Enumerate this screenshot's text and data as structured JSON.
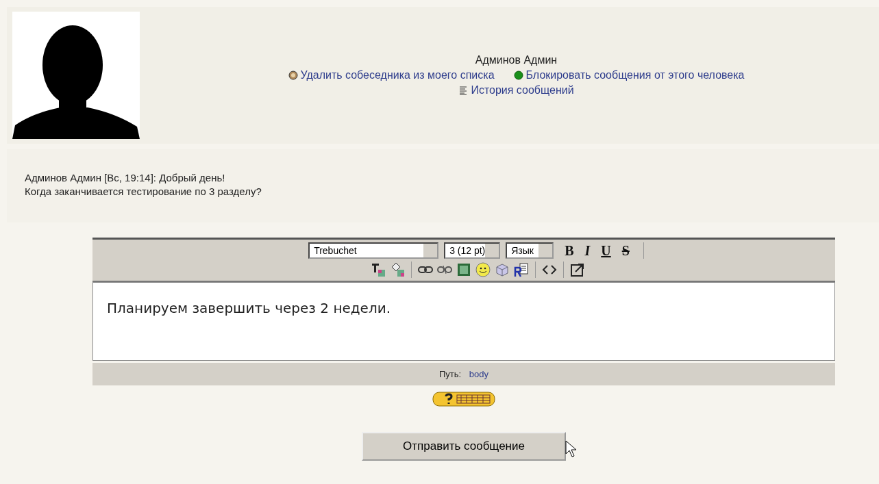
{
  "contact": {
    "name": "Админов Админ",
    "actions": [
      {
        "kind": "remove",
        "label": "Удалить собеседника из моего списка"
      },
      {
        "kind": "block",
        "label": "Блокировать сообщения от этого человека"
      },
      {
        "kind": "history",
        "label": "История сообщений"
      }
    ]
  },
  "message": {
    "lines": [
      "Админов Админ [Вс, 19:14]: Добрый день!",
      "Когда заканчивается тестирование по 3 разделу?"
    ]
  },
  "editor": {
    "font": "Trebuchet",
    "size": "3 (12 pt)",
    "language": "Язык",
    "format_buttons": [
      {
        "kind": "bold",
        "label": "B"
      },
      {
        "kind": "italic",
        "label": "I"
      },
      {
        "kind": "underline",
        "label": "U"
      },
      {
        "kind": "strike",
        "label": "S"
      }
    ],
    "body": "Планируем завершить через 2 недели.",
    "path_label": "Путь:",
    "path": "body"
  },
  "send_button": "Отправить сообщение"
}
